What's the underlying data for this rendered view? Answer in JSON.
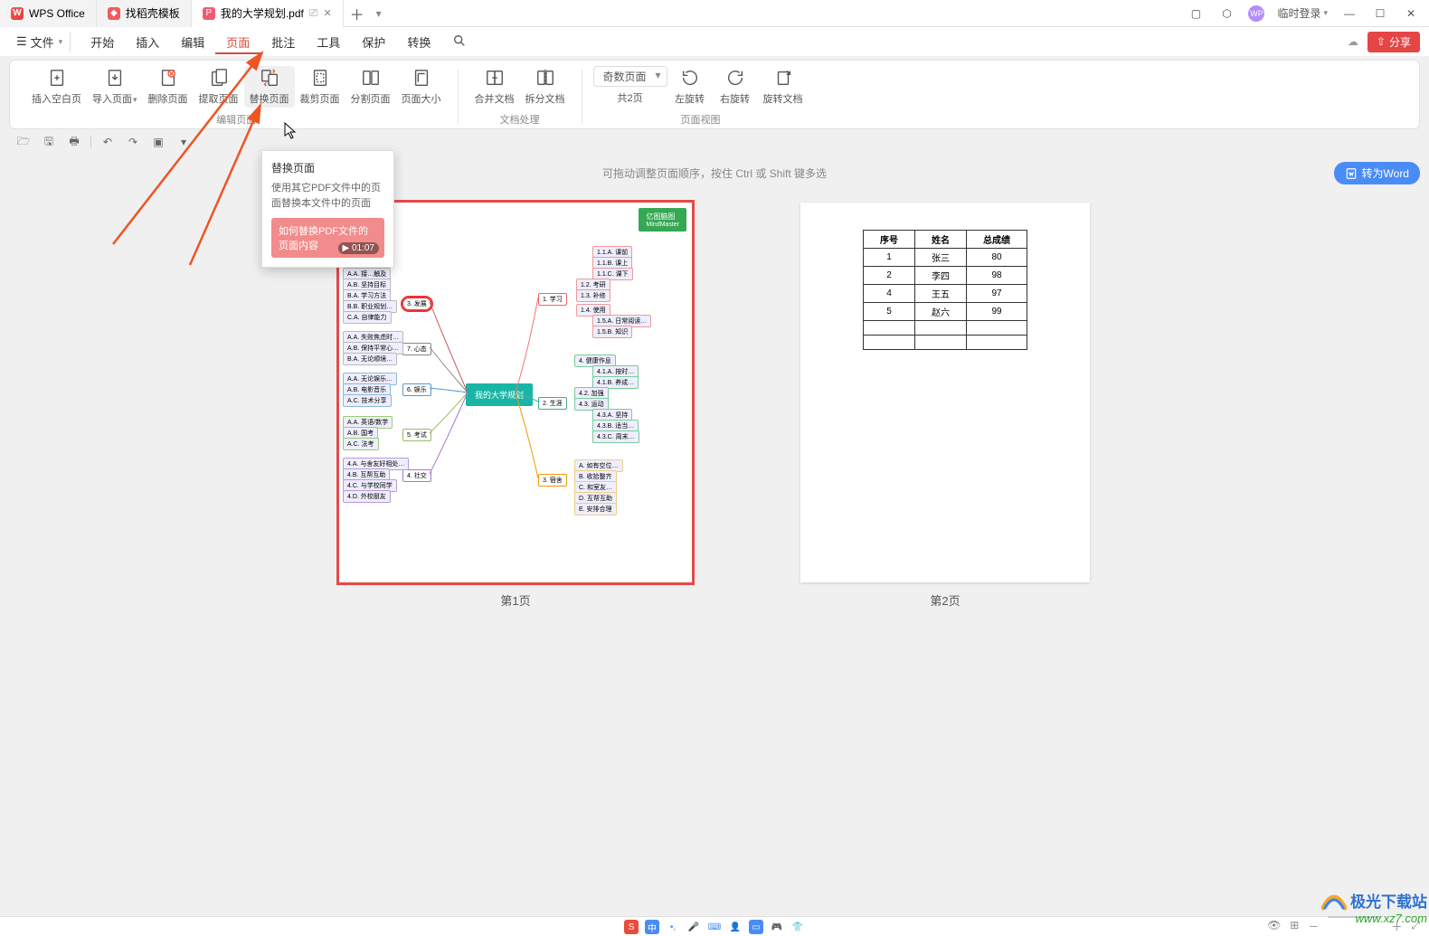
{
  "titlebar": {
    "tabs": [
      {
        "label": "WPS Office"
      },
      {
        "label": "找稻壳模板"
      },
      {
        "label": "我的大学规划.pdf"
      }
    ],
    "login": "临时登录",
    "user_badge": "WP"
  },
  "menubar": {
    "file": "文件",
    "items": [
      "开始",
      "插入",
      "编辑",
      "页面",
      "批注",
      "工具",
      "保护",
      "转换"
    ],
    "active": "页面",
    "share": "分享"
  },
  "ribbon": {
    "edit_group": {
      "label": "编辑页面",
      "items": {
        "insert_blank": "插入空白页",
        "import_page": "导入页面",
        "delete_page": "删除页面",
        "extract_page": "提取页面",
        "replace_page": "替换页面",
        "crop_page": "裁剪页面",
        "split_page": "分割页面",
        "page_size": "页面大小"
      }
    },
    "doc_group": {
      "label": "文档处理",
      "items": {
        "merge_doc": "合并文档",
        "split_doc": "拆分文档"
      }
    },
    "view_group": {
      "label": "页面视图",
      "page_mode": "奇数页面",
      "page_total": "共2页",
      "rotate_left": "左旋转",
      "rotate_right": "右旋转",
      "rotate_doc": "旋转文档"
    }
  },
  "tooltip": {
    "title": "替换页面",
    "desc": "使用其它PDF文件中的页面替换本文件中的页面",
    "video_title": "如何替换PDF文件的页面内容",
    "video_time": "01:07"
  },
  "main": {
    "hint": "可拖动调整页面顺序，按住 Ctrl 或 Shift 键多选",
    "to_word": "转为Word",
    "page1_label": "第1页",
    "page2_label": "第2页"
  },
  "page1": {
    "center": "我的大学规划",
    "badge_top": "亿图脑图",
    "badge_bottom": "MindMaster",
    "r_nodes": {
      "n1": "1. 学习",
      "n2": "2. 生涯",
      "n3": "3. 宿舍"
    },
    "l_nodes": {
      "n3": "3. 发展",
      "n4": "7. 心态",
      "n5": "6. 娱乐",
      "n6": "5. 考试",
      "n7": "4. 社交"
    }
  },
  "page2_table": {
    "headers": [
      "序号",
      "姓名",
      "总成绩"
    ],
    "rows": [
      [
        "1",
        "张三",
        "80"
      ],
      [
        "2",
        "李四",
        "98"
      ],
      [
        "4",
        "王五",
        "97"
      ],
      [
        "5",
        "赵六",
        "99"
      ],
      [
        "",
        "",
        ""
      ],
      [
        "",
        "",
        ""
      ]
    ]
  },
  "systray": {
    "input_method": "中"
  },
  "watermark": {
    "top": "极光下载站",
    "url": "www.xz7.com"
  }
}
